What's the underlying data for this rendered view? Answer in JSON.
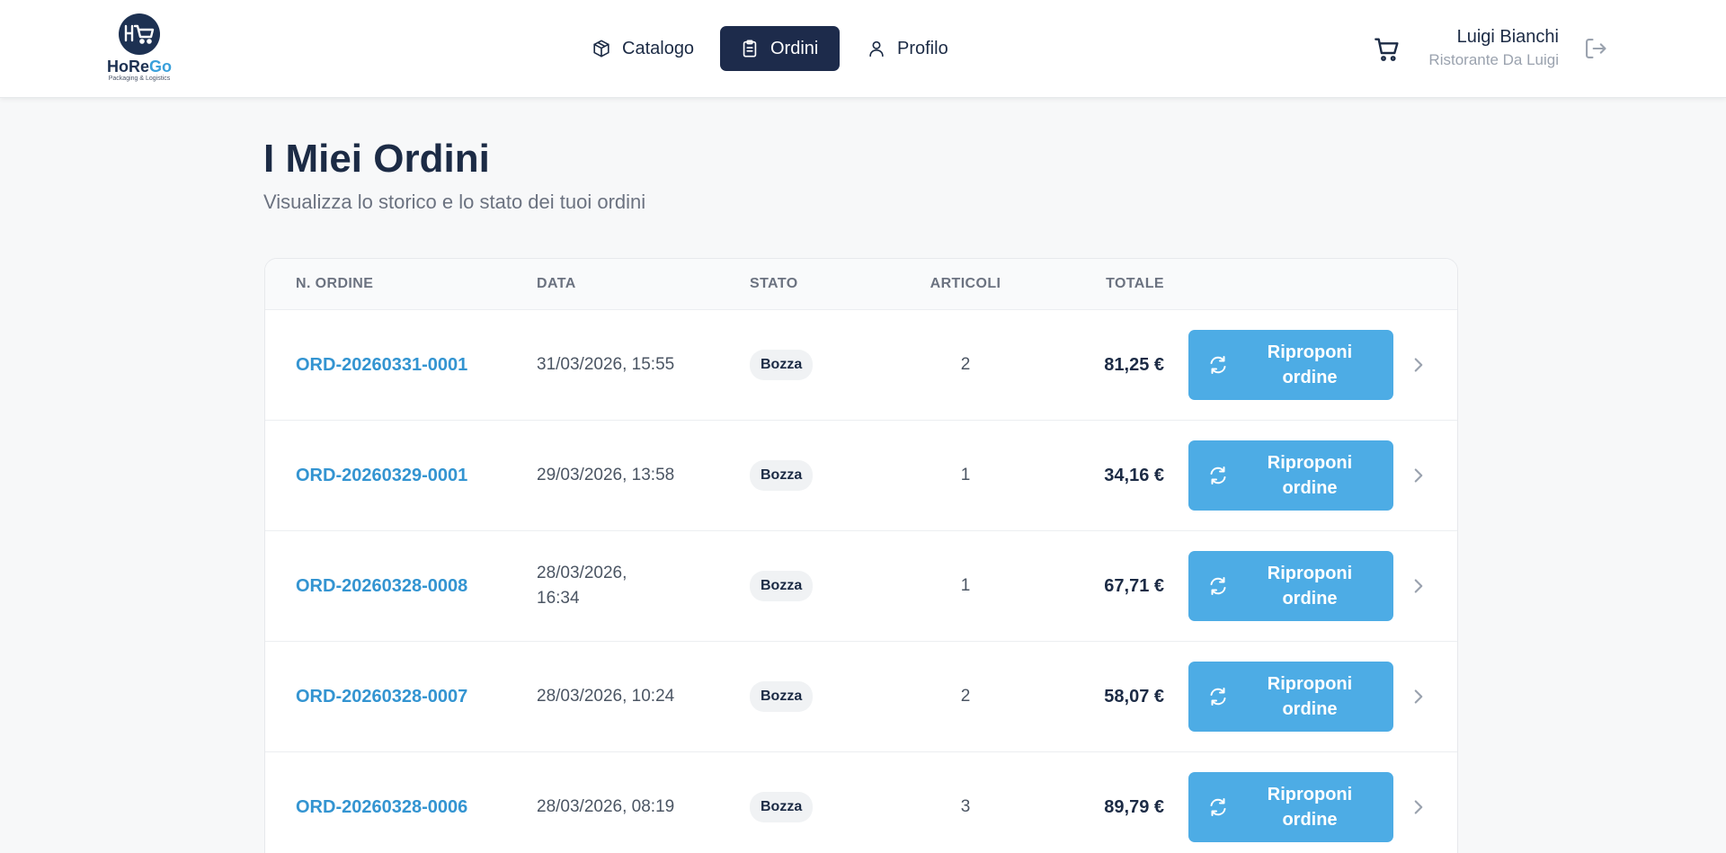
{
  "app": {
    "logo_text_a": "HoRe",
    "logo_text_b": "Go",
    "logo_tagline": "Packaging & Logistics",
    "brand_dark": "#1d3152",
    "brand_accent": "#3aa0db"
  },
  "nav": {
    "items": [
      {
        "label": "Catalogo",
        "icon": "box-icon",
        "active": false
      },
      {
        "label": "Ordini",
        "icon": "clipboard-icon",
        "active": true
      },
      {
        "label": "Profilo",
        "icon": "user-icon",
        "active": false
      }
    ]
  },
  "user": {
    "name": "Luigi Bianchi",
    "company": "Ristorante Da Luigi",
    "cart_icon": "cart-icon",
    "logout_icon": "logout-icon"
  },
  "page": {
    "title": "I Miei Ordini",
    "subtitle": "Visualizza lo storico e lo stato dei tuoi ordini"
  },
  "table": {
    "headers": {
      "number": "N. ORDINE",
      "date": "DATA",
      "status": "STATO",
      "items": "ARTICOLI",
      "total": "TOTALE"
    },
    "action_label": "Riproponi ordine",
    "action_icon": "refresh-icon",
    "rows": [
      {
        "number": "ORD-20260331-0001",
        "date": "31/03/2026, 15:55",
        "status": "Bozza",
        "items": "2",
        "total": "81,25 €"
      },
      {
        "number": "ORD-20260329-0001",
        "date": "29/03/2026, 13:58",
        "status": "Bozza",
        "items": "1",
        "total": "34,16 €"
      },
      {
        "number": "ORD-20260328-0008",
        "date": "28/03/2026, 16:34",
        "status": "Bozza",
        "items": "1",
        "total": "67,71 €"
      },
      {
        "number": "ORD-20260328-0007",
        "date": "28/03/2026, 10:24",
        "status": "Bozza",
        "items": "2",
        "total": "58,07 €"
      },
      {
        "number": "ORD-20260328-0006",
        "date": "28/03/2026, 08:19",
        "status": "Bozza",
        "items": "3",
        "total": "89,79 €"
      }
    ]
  }
}
